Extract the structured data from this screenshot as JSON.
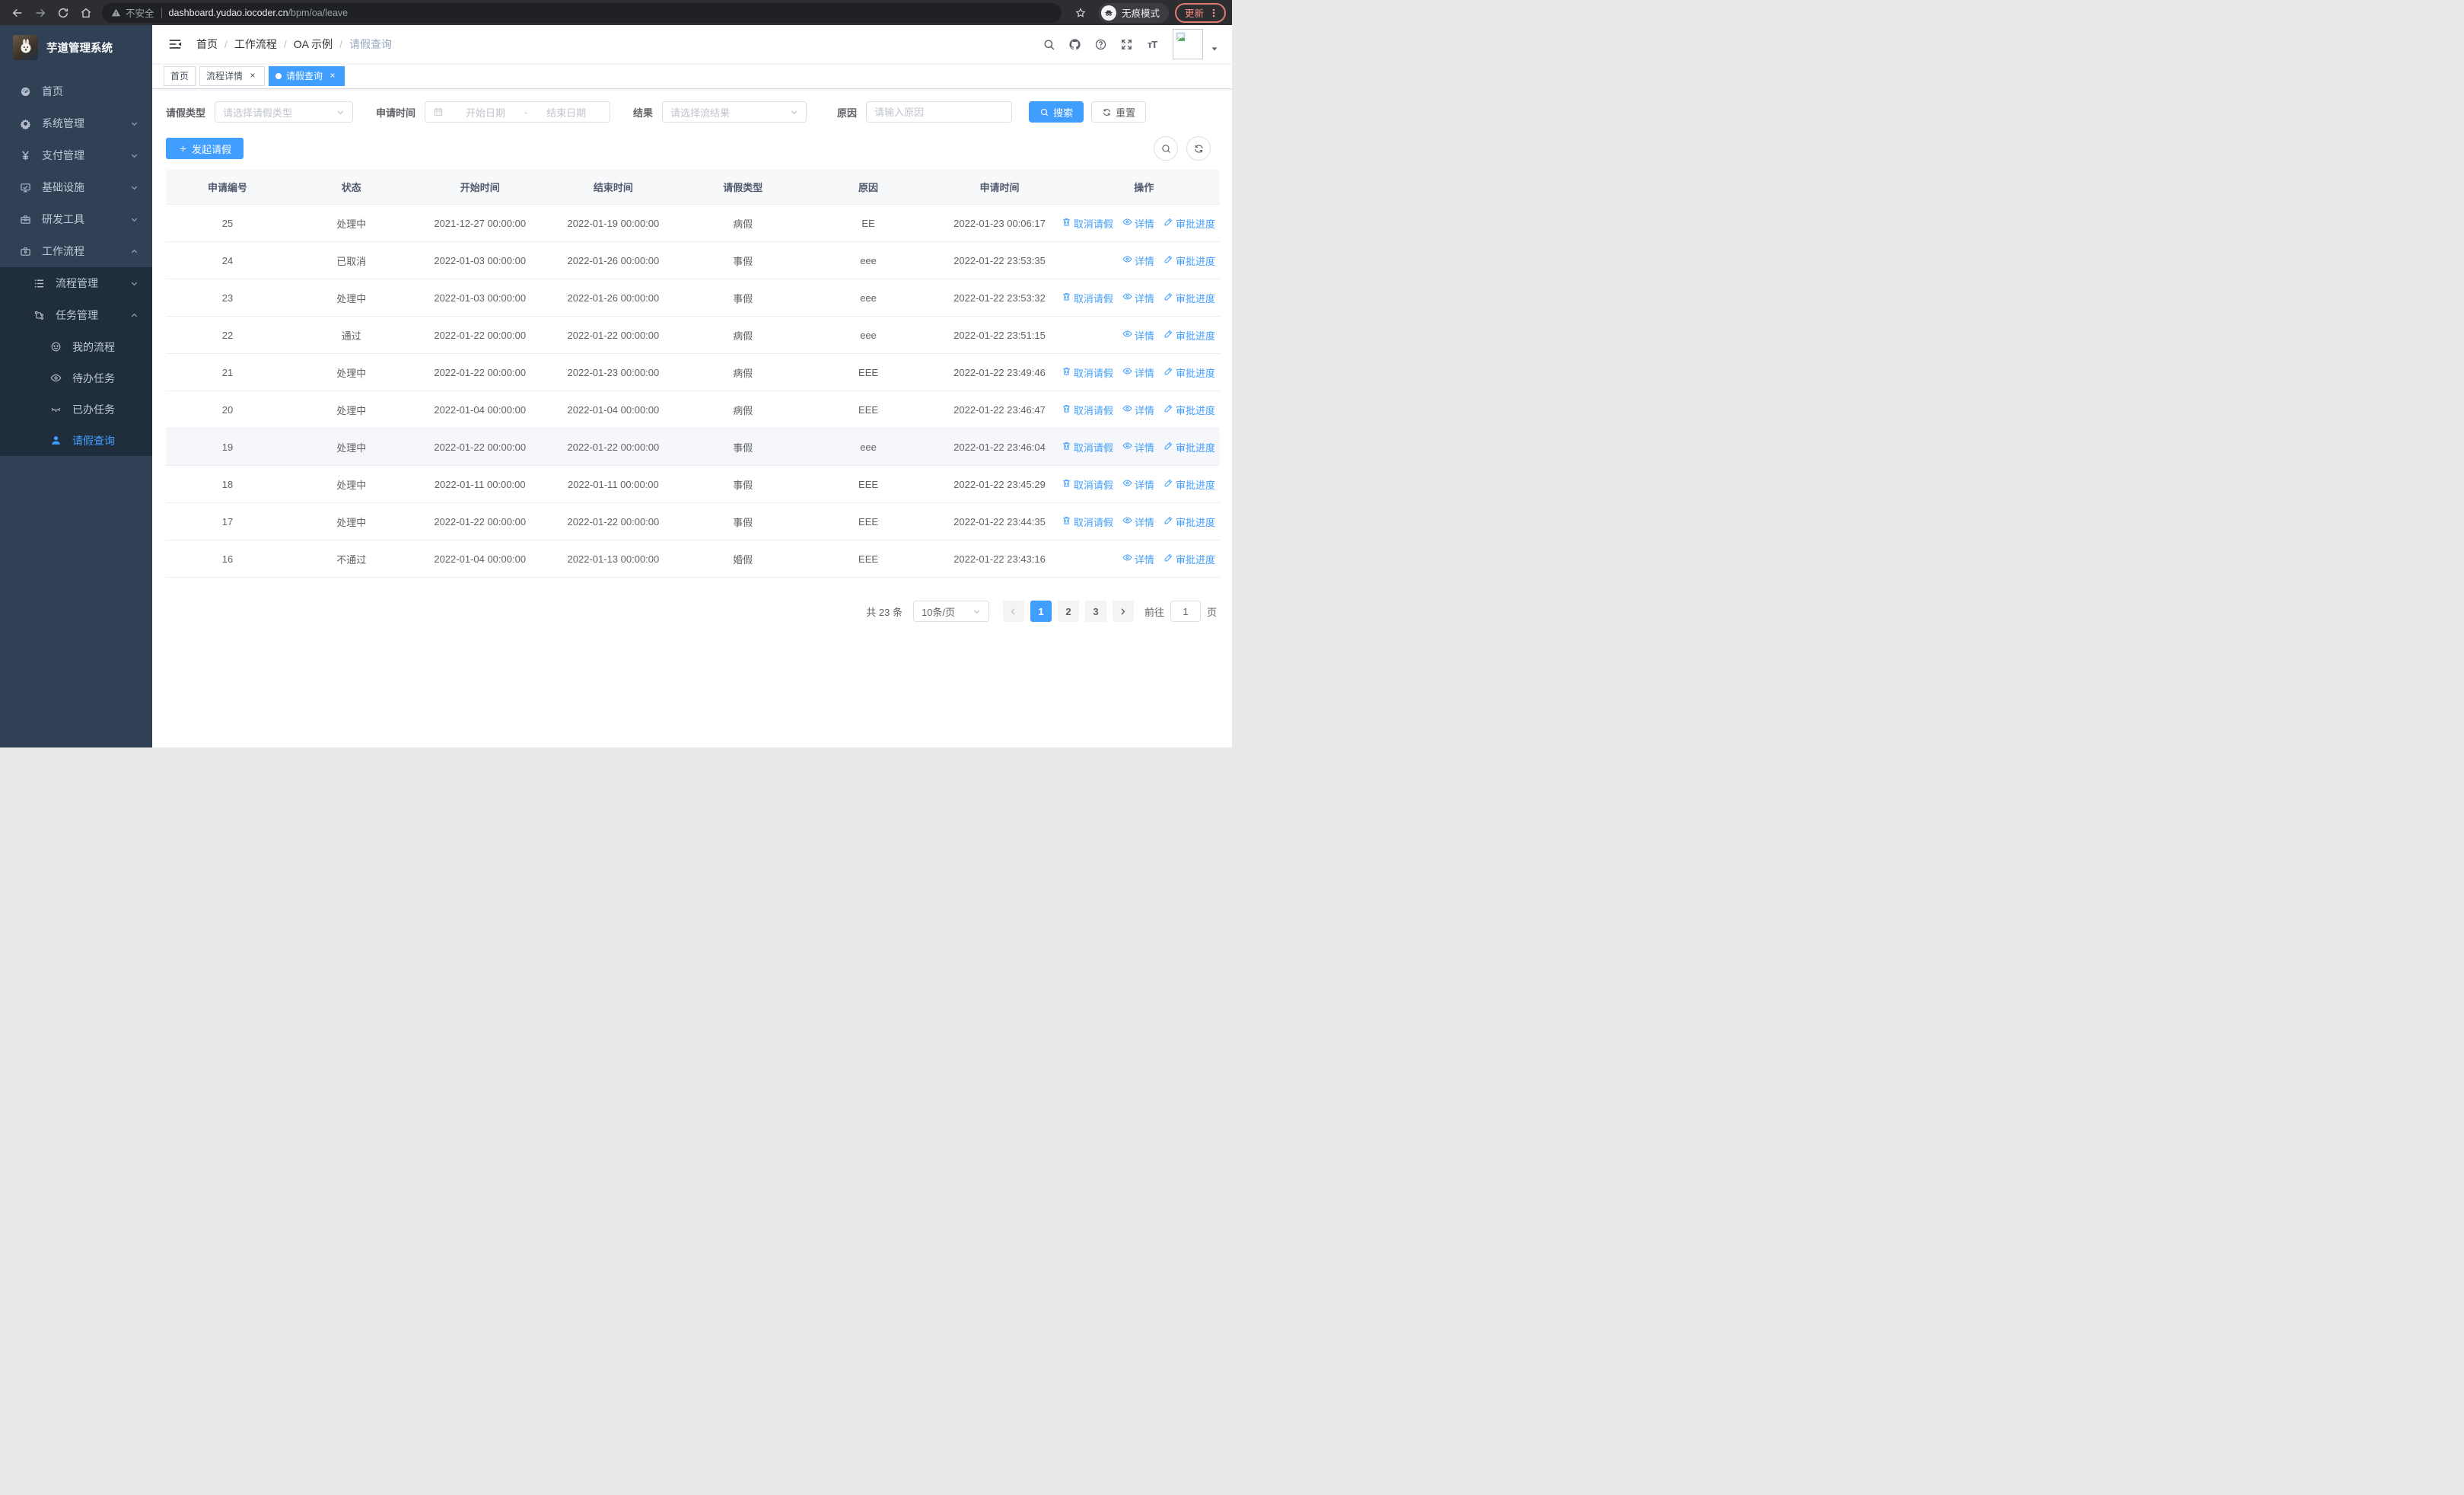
{
  "colors": {
    "accent": "#409eff",
    "sidebar_bg": "#304156",
    "submenu_bg": "#1f2d3d",
    "update_accent": "#f28b82",
    "table_header_bg": "#f7f8fa"
  },
  "browser": {
    "security_warning": "不安全",
    "url_host": "dashboard.yudao.iocoder.cn",
    "url_path": "/bpm/oa/leave",
    "incognito_label": "无痕模式",
    "update_label": "更新"
  },
  "sidebar": {
    "app_title": "芋道管理系统",
    "menu": [
      {
        "label": "首页",
        "icon": "dashboard",
        "level": 1,
        "sub": false,
        "chevron": "",
        "active": false
      },
      {
        "label": "系统管理",
        "icon": "gear",
        "level": 1,
        "sub": false,
        "chevron": "down",
        "active": false
      },
      {
        "label": "支付管理",
        "icon": "yen",
        "level": 1,
        "sub": false,
        "chevron": "down",
        "active": false
      },
      {
        "label": "基础设施",
        "icon": "monitor",
        "level": 1,
        "sub": false,
        "chevron": "down",
        "active": false
      },
      {
        "label": "研发工具",
        "icon": "toolbox",
        "level": 1,
        "sub": false,
        "chevron": "down",
        "active": false
      },
      {
        "label": "工作流程",
        "icon": "briefcase",
        "level": 1,
        "sub": false,
        "chevron": "up",
        "active": false
      },
      {
        "label": "流程管理",
        "icon": "list",
        "level": 2,
        "sub": true,
        "chevron": "down",
        "active": false
      },
      {
        "label": "任务管理",
        "icon": "tree",
        "level": 2,
        "sub": true,
        "chevron": "up",
        "active": false
      },
      {
        "label": "我的流程",
        "icon": "face",
        "level": 3,
        "sub": true,
        "chevron": "",
        "active": false
      },
      {
        "label": "待办任务",
        "icon": "eye",
        "level": 3,
        "sub": true,
        "chevron": "",
        "active": false
      },
      {
        "label": "已办任务",
        "icon": "eye-closed",
        "level": 3,
        "sub": true,
        "chevron": "",
        "active": false
      },
      {
        "label": "请假查询",
        "icon": "user",
        "level": 3,
        "sub": true,
        "chevron": "",
        "active": true
      }
    ]
  },
  "header": {
    "breadcrumb": [
      "首页",
      "工作流程",
      "OA 示例",
      "请假查询"
    ]
  },
  "tags": {
    "items": [
      {
        "label": "首页",
        "closable": false,
        "active": false
      },
      {
        "label": "流程详情",
        "closable": true,
        "active": false
      },
      {
        "label": "请假查询",
        "closable": true,
        "active": true
      }
    ]
  },
  "filters": {
    "type_label": "请假类型",
    "type_placeholder": "请选择请假类型",
    "time_label": "申请时间",
    "start_placeholder": "开始日期",
    "range_separator": "-",
    "end_placeholder": "结束日期",
    "result_label": "结果",
    "result_placeholder": "请选择流结果",
    "reason_label": "原因",
    "reason_placeholder": "请输入原因",
    "search_label": "搜索",
    "reset_label": "重置"
  },
  "toolbar": {
    "create_label": "发起请假"
  },
  "table": {
    "columns": [
      "申请编号",
      "状态",
      "开始时间",
      "结束时间",
      "请假类型",
      "原因",
      "申请时间",
      "操作"
    ],
    "action_labels": {
      "cancel": "取消请假",
      "detail": "详情",
      "progress": "审批进度"
    },
    "rows": [
      {
        "id": "25",
        "status": "处理中",
        "start": "2021-12-27 00:00:00",
        "end": "2022-01-19 00:00:00",
        "type": "病假",
        "reason": "EE",
        "applyTime": "2022-01-23 00:06:17",
        "actions": [
          "cancel",
          "detail",
          "progress"
        ],
        "highlight": false
      },
      {
        "id": "24",
        "status": "已取消",
        "start": "2022-01-03 00:00:00",
        "end": "2022-01-26 00:00:00",
        "type": "事假",
        "reason": "eee",
        "applyTime": "2022-01-22 23:53:35",
        "actions": [
          "detail",
          "progress"
        ],
        "highlight": false
      },
      {
        "id": "23",
        "status": "处理中",
        "start": "2022-01-03 00:00:00",
        "end": "2022-01-26 00:00:00",
        "type": "事假",
        "reason": "eee",
        "applyTime": "2022-01-22 23:53:32",
        "actions": [
          "cancel",
          "detail",
          "progress"
        ],
        "highlight": false
      },
      {
        "id": "22",
        "status": "通过",
        "start": "2022-01-22 00:00:00",
        "end": "2022-01-22 00:00:00",
        "type": "病假",
        "reason": "eee",
        "applyTime": "2022-01-22 23:51:15",
        "actions": [
          "detail",
          "progress"
        ],
        "highlight": false
      },
      {
        "id": "21",
        "status": "处理中",
        "start": "2022-01-22 00:00:00",
        "end": "2022-01-23 00:00:00",
        "type": "病假",
        "reason": "EEE",
        "applyTime": "2022-01-22 23:49:46",
        "actions": [
          "cancel",
          "detail",
          "progress"
        ],
        "highlight": false
      },
      {
        "id": "20",
        "status": "处理中",
        "start": "2022-01-04 00:00:00",
        "end": "2022-01-04 00:00:00",
        "type": "病假",
        "reason": "EEE",
        "applyTime": "2022-01-22 23:46:47",
        "actions": [
          "cancel",
          "detail",
          "progress"
        ],
        "highlight": false
      },
      {
        "id": "19",
        "status": "处理中",
        "start": "2022-01-22 00:00:00",
        "end": "2022-01-22 00:00:00",
        "type": "事假",
        "reason": "eee",
        "applyTime": "2022-01-22 23:46:04",
        "actions": [
          "cancel",
          "detail",
          "progress"
        ],
        "highlight": true
      },
      {
        "id": "18",
        "status": "处理中",
        "start": "2022-01-11 00:00:00",
        "end": "2022-01-11 00:00:00",
        "type": "事假",
        "reason": "EEE",
        "applyTime": "2022-01-22 23:45:29",
        "actions": [
          "cancel",
          "detail",
          "progress"
        ],
        "highlight": false
      },
      {
        "id": "17",
        "status": "处理中",
        "start": "2022-01-22 00:00:00",
        "end": "2022-01-22 00:00:00",
        "type": "事假",
        "reason": "EEE",
        "applyTime": "2022-01-22 23:44:35",
        "actions": [
          "cancel",
          "detail",
          "progress"
        ],
        "highlight": false
      },
      {
        "id": "16",
        "status": "不通过",
        "start": "2022-01-04 00:00:00",
        "end": "2022-01-13 00:00:00",
        "type": "婚假",
        "reason": "EEE",
        "applyTime": "2022-01-22 23:43:16",
        "actions": [
          "detail",
          "progress"
        ],
        "highlight": false
      }
    ]
  },
  "pagination": {
    "total_label": "共 23 条",
    "page_size_label": "10条/页",
    "pages": [
      "1",
      "2",
      "3"
    ],
    "active_page": "1",
    "goto_label": "前往",
    "goto_value": "1",
    "page_unit_label": "页"
  }
}
